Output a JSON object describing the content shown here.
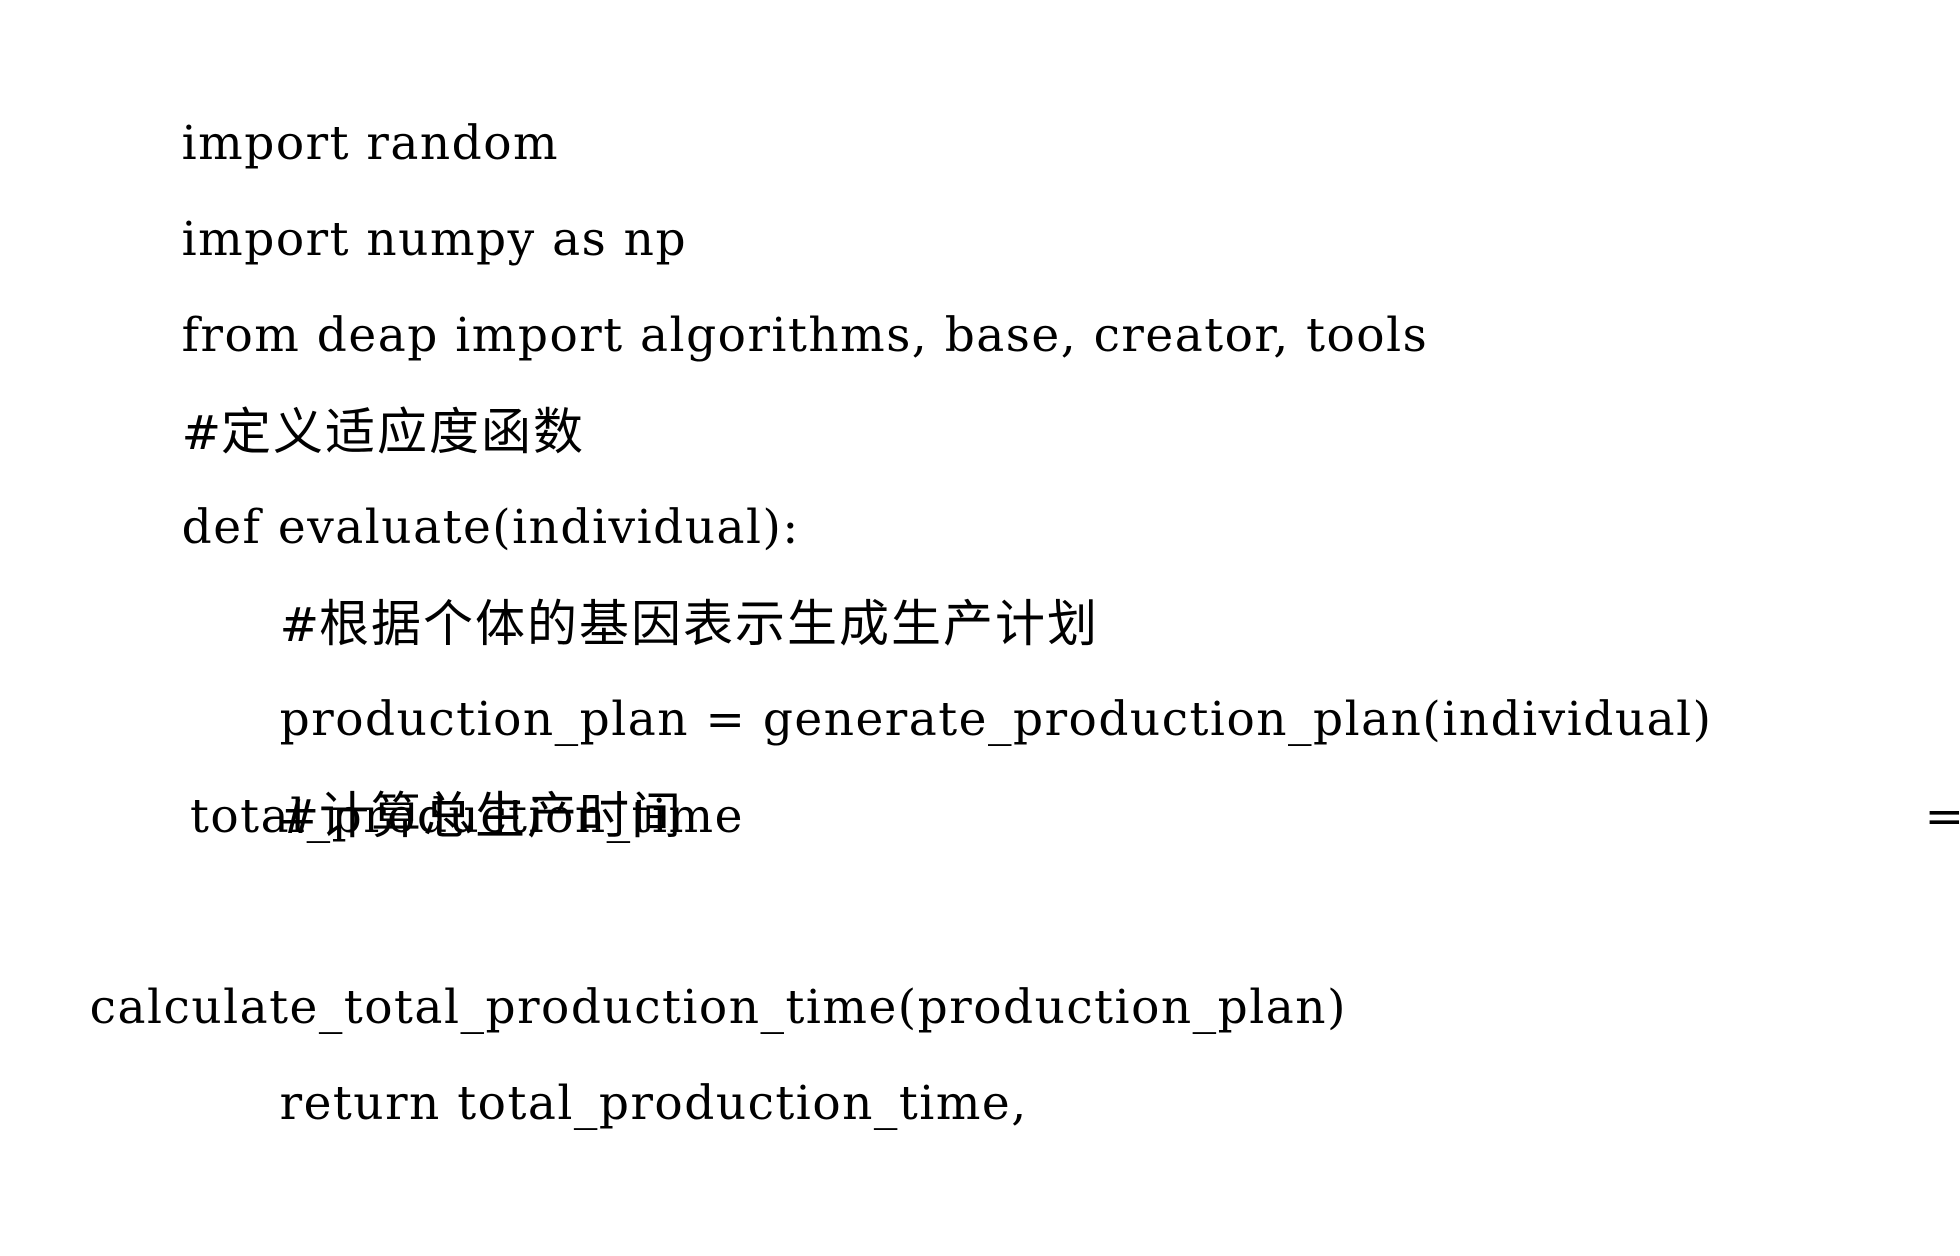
{
  "document": {
    "language": "python",
    "background_color": "#ffffff",
    "text_color": "#000000",
    "lines": [
      {
        "id": "import-random",
        "text": "import random"
      },
      {
        "id": "import-numpy",
        "text": "import numpy as np"
      },
      {
        "id": "from-deap-import",
        "text": "from deap import algorithms, base, creator, tools"
      },
      {
        "id": "comment-define-fitness",
        "text": "# 定义适应度函数"
      },
      {
        "id": "def-evaluate",
        "text": "def evaluate(individual):"
      },
      {
        "id": "comment-generate-plan",
        "text": "# 根据个体的基因表示生成生产计划"
      },
      {
        "id": "assign-production-plan",
        "text": "production_plan = generate_production_plan(individual)"
      },
      {
        "id": "comment-calc-total-time",
        "text": "# 计算总生产时间"
      },
      {
        "id": "assign-total-time-lhs",
        "text": "total_production_time"
      },
      {
        "id": "assign-total-time-eq",
        "text": "="
      },
      {
        "id": "assign-total-time-rhs",
        "text": "calculate_total_production_time(production_plan)"
      },
      {
        "id": "return-total-time",
        "text": "return total_production_time,"
      }
    ]
  },
  "code": {
    "line_1": "import random",
    "line_2": "import numpy as np",
    "line_3": "from deap import algorithms, base, creator, tools",
    "line_4_hash": "#",
    "line_4_comment": "定义适应度函数",
    "line_5": "def evaluate(individual):",
    "line_6_hash": "#",
    "line_6_comment": "根据个体的基因表示生成生产计划",
    "line_7": "production_plan = generate_production_plan(individual)",
    "line_8_hash": "#",
    "line_8_comment": "计算总生产时间",
    "line_9_lhs": "total_production_time",
    "line_9_eq": "=",
    "line_10_wrap": "calculate_total_production_time(production_plan)",
    "line_11": "return total_production_time,"
  }
}
